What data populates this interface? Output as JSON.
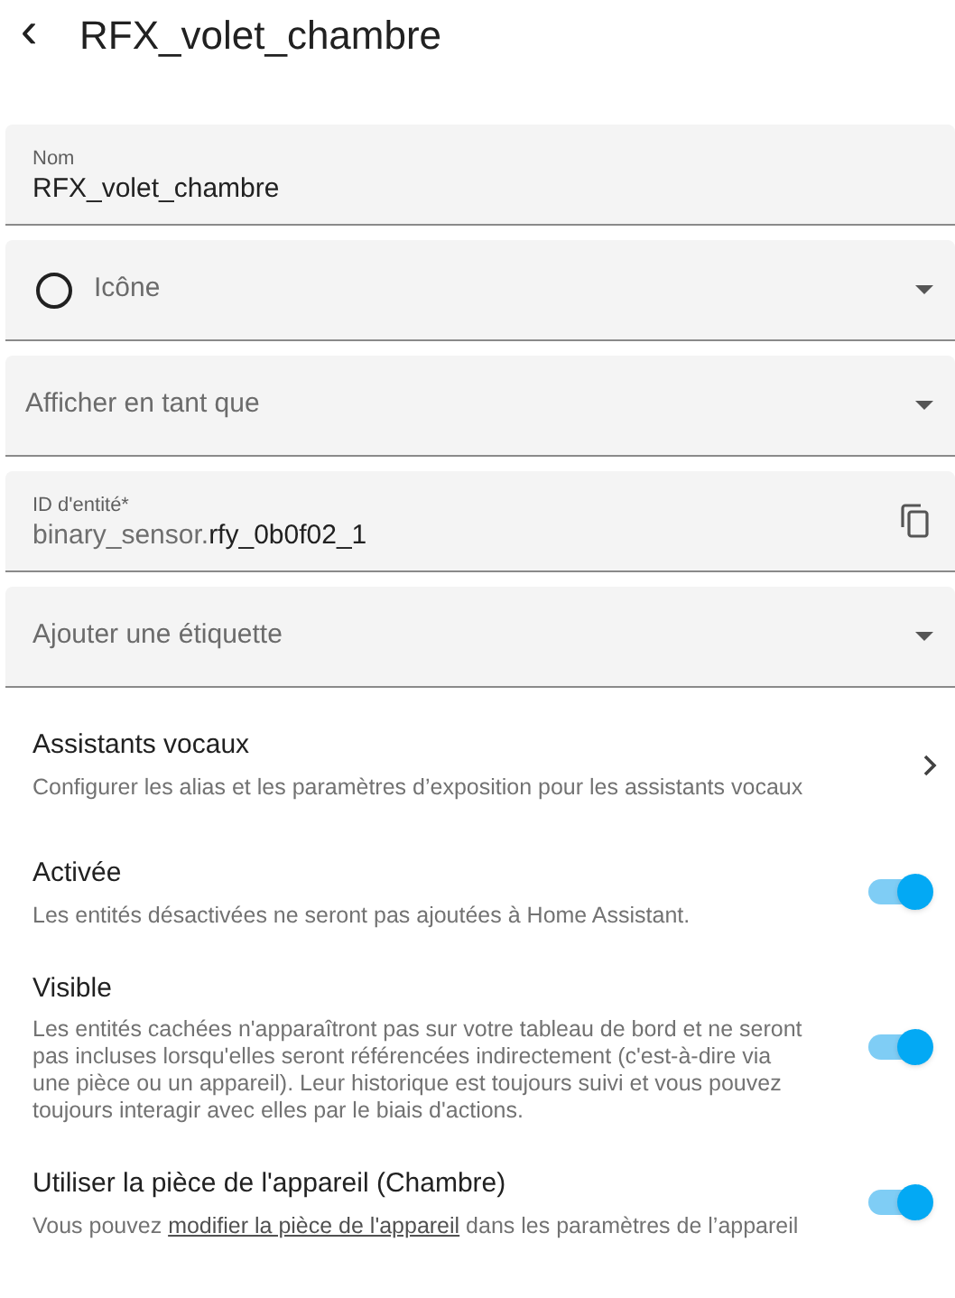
{
  "header": {
    "back": "‹",
    "title": "RFX_volet_chambre"
  },
  "fields": [
    {
      "kind": "text",
      "label": "Nom",
      "value": "RFX_volet_chambre"
    },
    {
      "kind": "icon-select",
      "placeholder": "Icône"
    },
    {
      "kind": "select",
      "placeholder": "Afficher en tant que"
    },
    {
      "kind": "entity-id",
      "label": "ID d'entité*",
      "value_prefix": "binary_sensor.",
      "value": "rfy_0b0f02_1"
    },
    {
      "kind": "select",
      "placeholder": "Ajouter une étiquette"
    }
  ],
  "voice": {
    "title": "Assistants vocaux",
    "description": "Configurer les alias et les paramètres d’exposition pour les assistants vocaux"
  },
  "toggles": [
    {
      "title": "Activée",
      "description": "Les entités désactivées ne seront pas ajoutées à Home Assistant.",
      "on": true
    },
    {
      "title": "Visible",
      "description": "Les entités cachées n'apparaîtront pas sur votre tableau de bord et ne seront pas incluses lorsqu'elles seront référencées indirectement (c'est-à-dire via une pièce ou un appareil). Leur historique est toujours suivi et vous pouvez toujours interagir avec elles par le biais d'actions.",
      "on": true
    },
    {
      "title": "Utiliser la pièce de l'appareil (Chambre)",
      "description_before": "Vous pouvez ",
      "link": "modifier la pièce de l'appareil",
      "description_after": " dans les paramètres de l’appareil",
      "on": true
    }
  ]
}
